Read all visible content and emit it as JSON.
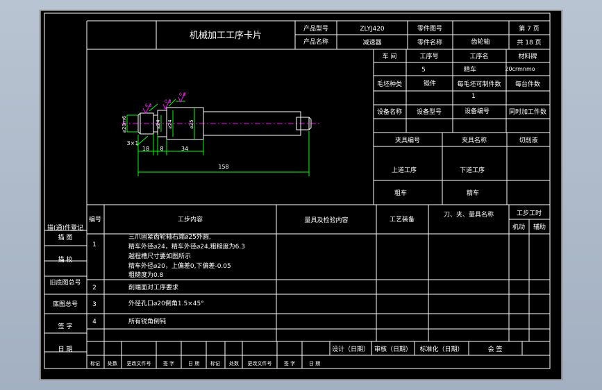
{
  "header": {
    "title": "机械加工工序卡片",
    "product_model_label": "产品型号",
    "product_model_value": "ZLYJ420",
    "part_drawing_label": "零件图号",
    "part_drawing_value": "",
    "page_no": "第 7 页",
    "product_name_label": "产品名称",
    "product_name_value": "减速器",
    "part_name_label": "零件名称",
    "part_name_value": "齿轮轴",
    "page_total": "共 18 页"
  },
  "info": {
    "workshop_label": "车  间",
    "process_no_label": "工序号",
    "process_name_label": "工序名",
    "material_label": "材料牌",
    "workshop_value": "",
    "process_no_value": "5",
    "process_name_value": "精车",
    "material_value": "20crmnmo",
    "blank_type_label": "毛坯种类",
    "blank_type_value": "锻件",
    "parts_per_blank_label": "每毛坯可制件数",
    "parts_per_blank_value": "1",
    "per_unit_label": "每台件数",
    "equipment_name_label": "设备名称",
    "equipment_model_label": "设备型号",
    "equipment_no_label": "设备编号",
    "simultaneous_label": "同时加工件数",
    "fixture_no_label": "夹具编号",
    "fixture_name_label": "夹具名称",
    "coolant_label": "切削液",
    "prev_process_label": "上道工序",
    "next_process_label": "下道工序",
    "prev_process_value": "粗车",
    "next_process_value": "精车"
  },
  "drawing": {
    "dims": {
      "d20": "⌀20m6",
      "d24a": "⌀24",
      "d24b": "⌀24",
      "d25": "⌀25",
      "chamfer": "3×1",
      "l18": "18",
      "l8": "8",
      "l34": "34",
      "l158": "158",
      "ra1": "6.3",
      "ra2": "0.8",
      "ra3": "0.8"
    }
  },
  "steps_table": {
    "headers": {
      "no": "编号",
      "content": "工步内容",
      "measure": "量具及检验内容",
      "equipment": "工艺装备",
      "tools": "刀、夹、量具名称",
      "hours": "工步工时",
      "machine": "机动",
      "aux": "辅助"
    },
    "rows": [
      {
        "no": "1",
        "lines": [
          "三爪固紧齿轮轴右端⌀25外圆,",
          "精车外径⌀24，精车外径⌀24,粗糙度为6.3",
          "越程槽尺寸要如图所示",
          "精车外径⌀20，上偏差0,下偏差-0.05",
          "粗糙度为0.8"
        ]
      },
      {
        "no": "2",
        "lines": [
          "削端面对工序要求"
        ]
      },
      {
        "no": "3",
        "lines": [
          "外径孔口⌀20倒角1.5×45°"
        ]
      },
      {
        "no": "4",
        "lines": [
          "所有锐角倒钝"
        ]
      }
    ]
  },
  "left_column": {
    "labels": [
      "描(通)件登记",
      "描    图",
      "描    校",
      "旧底图总号",
      "底图总号",
      "签    字",
      "日    期"
    ]
  },
  "footer": {
    "design": "设计（日期）",
    "review": "审核（日期）",
    "standard": "标准化（日期）",
    "countersign": "会    签",
    "row": [
      "标记",
      "处数",
      "更改文件号",
      "签  字",
      "日  期",
      "标记",
      "处数",
      "更改文件号",
      "签  字",
      "日  期"
    ]
  }
}
